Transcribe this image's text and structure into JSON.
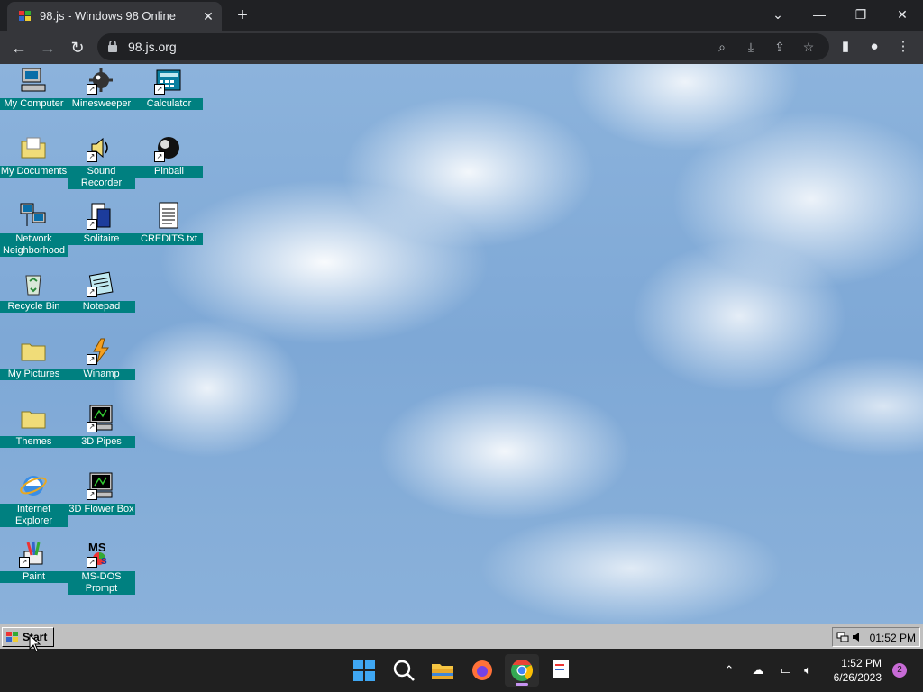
{
  "browser": {
    "tab_title": "98.js - Windows 98 Online",
    "url": "98.js.org",
    "new_tab_symbol": "+",
    "close_tab_symbol": "✕",
    "window_controls": {
      "dropdown": "⌄",
      "minimize": "—",
      "restore": "❐",
      "close": "✕"
    }
  },
  "desktop": {
    "icons": [
      {
        "label": "My Computer",
        "icon": "computer-icon",
        "shortcut": false
      },
      {
        "label": "Minesweeper",
        "icon": "minesweeper-icon",
        "shortcut": true
      },
      {
        "label": "Calculator",
        "icon": "calculator-icon",
        "shortcut": true
      },
      {
        "label": "My Documents",
        "icon": "documents-folder-icon",
        "shortcut": false
      },
      {
        "label": "Sound Recorder",
        "icon": "sound-recorder-icon",
        "shortcut": true
      },
      {
        "label": "Pinball",
        "icon": "pinball-icon",
        "shortcut": true
      },
      {
        "label": "Network Neighborhood",
        "icon": "network-icon",
        "shortcut": false
      },
      {
        "label": "Solitaire",
        "icon": "solitaire-icon",
        "shortcut": true
      },
      {
        "label": "CREDITS.txt",
        "icon": "text-file-icon",
        "shortcut": false
      },
      {
        "label": "Recycle Bin",
        "icon": "recycle-bin-icon",
        "shortcut": false
      },
      {
        "label": "Notepad",
        "icon": "notepad-icon",
        "shortcut": true
      },
      {
        "label": "My Pictures",
        "icon": "folder-icon",
        "shortcut": false
      },
      {
        "label": "Winamp",
        "icon": "winamp-icon",
        "shortcut": true
      },
      {
        "label": "Themes",
        "icon": "folder-icon",
        "shortcut": false
      },
      {
        "label": "3D Pipes",
        "icon": "screensaver-icon",
        "shortcut": true
      },
      {
        "label": "Internet Explorer",
        "icon": "internet-explorer-icon",
        "shortcut": false
      },
      {
        "label": "3D Flower Box",
        "icon": "screensaver-icon",
        "shortcut": true
      },
      {
        "label": "Paint",
        "icon": "paint-icon",
        "shortcut": true
      },
      {
        "label": "MS-DOS Prompt",
        "icon": "msdos-icon",
        "shortcut": true
      }
    ]
  },
  "taskbar98": {
    "start_label": "Start",
    "clock": "01:52 PM"
  },
  "taskbar11": {
    "time": "1:52 PM",
    "date": "6/26/2023",
    "notification_count": "2",
    "apps": [
      "start-icon",
      "search-icon",
      "file-explorer-icon",
      "firefox-icon",
      "chrome-icon",
      "snipping-tool-icon"
    ]
  },
  "colors": {
    "icon_label_bg": "#008080",
    "win98_gray": "#c0c0c0",
    "chrome_dark": "#202124"
  }
}
